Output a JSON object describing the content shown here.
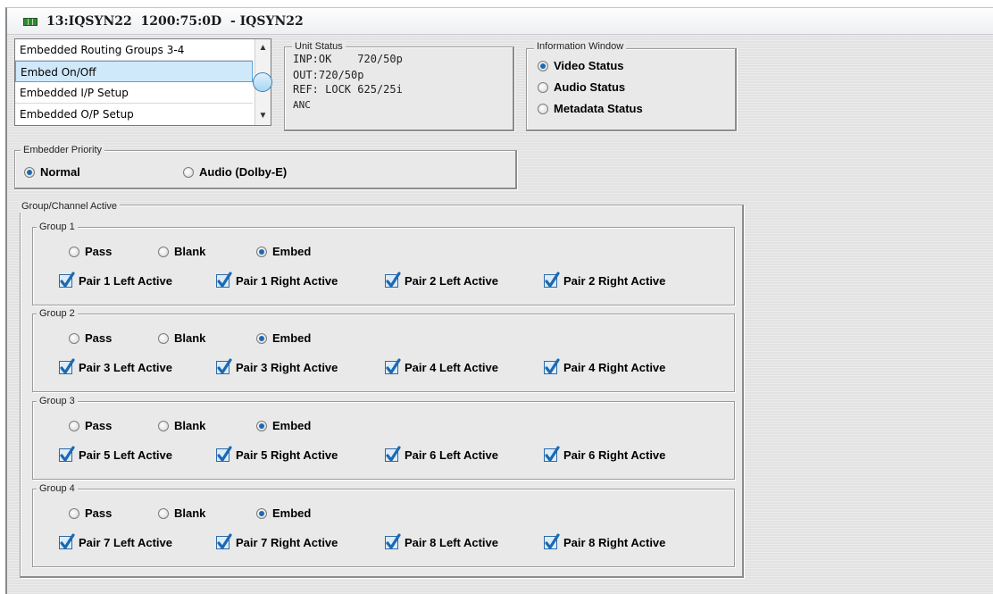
{
  "window": {
    "title": "13:IQSYN22  1200:75:0D  - IQSYN22"
  },
  "menu_list": {
    "items": [
      {
        "label": "Embedded Routing Groups 3-4",
        "selected": false
      },
      {
        "label": "Embed On/Off",
        "selected": true
      },
      {
        "label": "Embedded I/P Setup",
        "selected": false
      },
      {
        "label": "Embedded O/P Setup",
        "selected": false
      }
    ]
  },
  "unit_status": {
    "legend": "Unit Status",
    "lines": [
      "INP:OK    720/50p",
      "OUT:720/50p",
      "REF: LOCK 625/25i",
      "ANC"
    ]
  },
  "information_window": {
    "legend": "Information Window",
    "options": [
      {
        "label": "Video Status",
        "selected": true
      },
      {
        "label": "Audio Status",
        "selected": false
      },
      {
        "label": "Metadata Status",
        "selected": false
      }
    ]
  },
  "embedder_priority": {
    "legend": "Embedder Priority",
    "options": [
      {
        "label": "Normal",
        "selected": true
      },
      {
        "label": "Audio (Dolby-E)",
        "selected": false
      }
    ]
  },
  "group_channel_active": {
    "legend": "Group/Channel Active",
    "groups": [
      {
        "legend": "Group 1",
        "modes": [
          {
            "label": "Pass",
            "selected": false
          },
          {
            "label": "Blank",
            "selected": false
          },
          {
            "label": "Embed",
            "selected": true
          }
        ],
        "pairs": [
          {
            "label": "Pair 1 Left Active",
            "checked": true
          },
          {
            "label": "Pair 1 Right Active",
            "checked": true
          },
          {
            "label": "Pair 2 Left Active",
            "checked": true
          },
          {
            "label": "Pair 2 Right Active",
            "checked": true
          }
        ]
      },
      {
        "legend": "Group 2",
        "modes": [
          {
            "label": "Pass",
            "selected": false
          },
          {
            "label": "Blank",
            "selected": false
          },
          {
            "label": "Embed",
            "selected": true
          }
        ],
        "pairs": [
          {
            "label": "Pair 3 Left Active",
            "checked": true
          },
          {
            "label": "Pair 3 Right Active",
            "checked": true
          },
          {
            "label": "Pair 4 Left Active",
            "checked": true
          },
          {
            "label": "Pair 4 Right Active",
            "checked": true
          }
        ]
      },
      {
        "legend": "Group 3",
        "modes": [
          {
            "label": "Pass",
            "selected": false
          },
          {
            "label": "Blank",
            "selected": false
          },
          {
            "label": "Embed",
            "selected": true
          }
        ],
        "pairs": [
          {
            "label": "Pair 5 Left Active",
            "checked": true
          },
          {
            "label": "Pair 5 Right Active",
            "checked": true
          },
          {
            "label": "Pair 6 Left Active",
            "checked": true
          },
          {
            "label": "Pair 6 Right Active",
            "checked": true
          }
        ]
      },
      {
        "legend": "Group 4",
        "modes": [
          {
            "label": "Pass",
            "selected": false
          },
          {
            "label": "Blank",
            "selected": false
          },
          {
            "label": "Embed",
            "selected": true
          }
        ],
        "pairs": [
          {
            "label": "Pair 7 Left Active",
            "checked": true
          },
          {
            "label": "Pair 7 Right Active",
            "checked": true
          },
          {
            "label": "Pair 8 Left Active",
            "checked": true
          },
          {
            "label": "Pair 8 Right Active",
            "checked": true
          }
        ]
      }
    ]
  },
  "colors": {
    "accent": "#1c69b3",
    "selection": "#cfe9fa",
    "panel_bg": "#e9e9e9"
  }
}
